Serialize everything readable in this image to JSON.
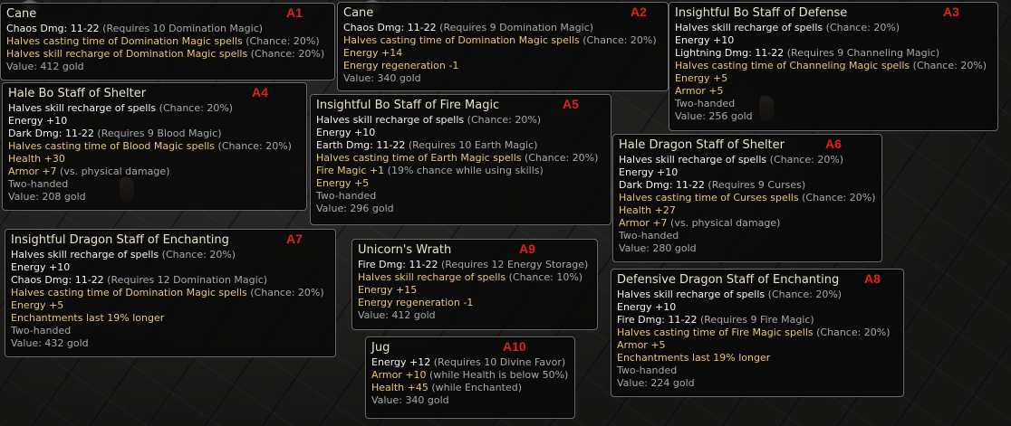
{
  "items": [
    {
      "id": "a1",
      "tag": "A1",
      "title": "Cane",
      "lines": [
        {
          "t": "Chaos Dmg: 11-22",
          "n": " (Requires 10 Domination Magic)",
          "c": "white"
        },
        {
          "t": "Halves casting time of Domination Magic spells",
          "n": " (Chance: 20%)",
          "c": "gold"
        },
        {
          "t": "Halves skill recharge of Domination Magic spells",
          "n": " (Chance: 20%)",
          "c": "gold"
        },
        {
          "t": "Value: 412 gold",
          "n": "",
          "c": "grey"
        }
      ]
    },
    {
      "id": "a2",
      "tag": "A2",
      "title": "Cane",
      "lines": [
        {
          "t": "Chaos Dmg: 11-22",
          "n": " (Requires 9 Domination Magic)",
          "c": "white"
        },
        {
          "t": "Halves casting time of Domination Magic spells",
          "n": " (Chance: 20%)",
          "c": "gold"
        },
        {
          "t": "Energy +14",
          "n": "",
          "c": "gold"
        },
        {
          "t": "Energy regeneration -1",
          "n": "",
          "c": "gold"
        },
        {
          "t": "Value: 340 gold",
          "n": "",
          "c": "grey"
        }
      ]
    },
    {
      "id": "a3",
      "tag": "A3",
      "title": "Insightful Bo Staff of Defense",
      "lines": [
        {
          "t": "Halves skill recharge of spells",
          "n": " (Chance: 20%)",
          "c": "white"
        },
        {
          "t": "Energy +10",
          "n": "",
          "c": "white"
        },
        {
          "t": "Lightning Dmg: 11-22",
          "n": " (Requires 9 Channeling Magic)",
          "c": "white"
        },
        {
          "t": "Halves casting time of Channeling Magic spells",
          "n": " (Chance: 20%)",
          "c": "gold"
        },
        {
          "t": "Energy +5",
          "n": "",
          "c": "gold"
        },
        {
          "t": "Armor +5",
          "n": "",
          "c": "gold"
        },
        {
          "t": "Two-handed",
          "n": "",
          "c": "grey"
        },
        {
          "t": "Value: 256 gold",
          "n": "",
          "c": "grey"
        }
      ]
    },
    {
      "id": "a4",
      "tag": "A4",
      "title": "Hale Bo Staff of Shelter",
      "lines": [
        {
          "t": "Halves skill recharge of spells",
          "n": " (Chance: 20%)",
          "c": "white"
        },
        {
          "t": "Energy +10",
          "n": "",
          "c": "white"
        },
        {
          "t": "Dark Dmg: 11-22",
          "n": " (Requires 9 Blood Magic)",
          "c": "white"
        },
        {
          "t": "Halves casting time of Blood Magic spells",
          "n": " (Chance: 20%)",
          "c": "gold"
        },
        {
          "t": "Health +30",
          "n": "",
          "c": "gold"
        },
        {
          "t": "Armor +7",
          "n": " (vs. physical damage)",
          "c": "gold"
        },
        {
          "t": "Two-handed",
          "n": "",
          "c": "grey"
        },
        {
          "t": "Value: 208 gold",
          "n": "",
          "c": "grey"
        }
      ]
    },
    {
      "id": "a5",
      "tag": "A5",
      "title": "Insightful Bo Staff of Fire Magic",
      "lines": [
        {
          "t": "Halves skill recharge of spells",
          "n": " (Chance: 20%)",
          "c": "white"
        },
        {
          "t": "Energy +10",
          "n": "",
          "c": "white"
        },
        {
          "t": "Earth Dmg: 11-22",
          "n": " (Requires 10 Earth Magic)",
          "c": "white"
        },
        {
          "t": "Halves casting time of Earth Magic spells",
          "n": " (Chance: 20%)",
          "c": "gold"
        },
        {
          "t": "Fire Magic +1",
          "n": " (19% chance while using skills)",
          "c": "gold"
        },
        {
          "t": "Energy +5",
          "n": "",
          "c": "gold"
        },
        {
          "t": "Two-handed",
          "n": "",
          "c": "grey"
        },
        {
          "t": "Value: 296 gold",
          "n": "",
          "c": "grey"
        }
      ]
    },
    {
      "id": "a6",
      "tag": "A6",
      "title": "Hale Dragon Staff of Shelter",
      "lines": [
        {
          "t": "Halves skill recharge of spells",
          "n": " (Chance: 20%)",
          "c": "white"
        },
        {
          "t": "Energy +10",
          "n": "",
          "c": "white"
        },
        {
          "t": "Dark Dmg: 11-22",
          "n": " (Requires 9 Curses)",
          "c": "white"
        },
        {
          "t": "Halves casting time of Curses spells",
          "n": " (Chance: 20%)",
          "c": "gold"
        },
        {
          "t": "Health +27",
          "n": "",
          "c": "gold"
        },
        {
          "t": "Armor +7",
          "n": " (vs. physical damage)",
          "c": "gold"
        },
        {
          "t": "Two-handed",
          "n": "",
          "c": "grey"
        },
        {
          "t": "Value: 280 gold",
          "n": "",
          "c": "grey"
        }
      ]
    },
    {
      "id": "a7",
      "tag": "A7",
      "title": "Insightful Dragon Staff of Enchanting",
      "lines": [
        {
          "t": "Halves skill recharge of spells",
          "n": " (Chance: 20%)",
          "c": "white"
        },
        {
          "t": "Energy +10",
          "n": "",
          "c": "white"
        },
        {
          "t": "Chaos Dmg: 11-22",
          "n": " (Requires 12 Domination Magic)",
          "c": "white"
        },
        {
          "t": "Halves casting time of Domination Magic spells",
          "n": " (Chance: 20%)",
          "c": "gold"
        },
        {
          "t": "Energy +5",
          "n": "",
          "c": "gold"
        },
        {
          "t": "Enchantments last 19% longer",
          "n": "",
          "c": "gold"
        },
        {
          "t": "Two-handed",
          "n": "",
          "c": "grey"
        },
        {
          "t": "Value: 432 gold",
          "n": "",
          "c": "grey"
        }
      ]
    },
    {
      "id": "a8",
      "tag": "A8",
      "title": "Defensive Dragon Staff of Enchanting",
      "lines": [
        {
          "t": "Halves skill recharge of spells",
          "n": " (Chance: 20%)",
          "c": "white"
        },
        {
          "t": "Energy +10",
          "n": "",
          "c": "white"
        },
        {
          "t": "Fire Dmg: 11-22",
          "n": " (Requires 9 Fire Magic)",
          "c": "white"
        },
        {
          "t": "Halves casting time of Fire Magic spells",
          "n": " (Chance: 20%)",
          "c": "gold"
        },
        {
          "t": "Armor +5",
          "n": "",
          "c": "gold"
        },
        {
          "t": "Enchantments last 19% longer",
          "n": "",
          "c": "gold"
        },
        {
          "t": "Two-handed",
          "n": "",
          "c": "grey"
        },
        {
          "t": "Value: 224 gold",
          "n": "",
          "c": "grey"
        }
      ]
    },
    {
      "id": "a9",
      "tag": "A9",
      "title": "Unicorn's Wrath",
      "lines": [
        {
          "t": "Fire Dmg: 11-22",
          "n": " (Requires 12 Energy Storage)",
          "c": "white"
        },
        {
          "t": "Halves skill recharge of spells",
          "n": " (Chance: 10%)",
          "c": "gold"
        },
        {
          "t": "Energy +15",
          "n": "",
          "c": "gold"
        },
        {
          "t": "Energy regeneration -1",
          "n": "",
          "c": "gold"
        },
        {
          "t": "Value: 412 gold",
          "n": "",
          "c": "grey"
        }
      ]
    },
    {
      "id": "a10",
      "tag": "A10",
      "title": "Jug",
      "lines": [
        {
          "t": "Energy +12",
          "n": " (Requires 10 Divine Favor)",
          "c": "white"
        },
        {
          "t": "Armor +10",
          "n": " (while Health is below 50%)",
          "c": "gold"
        },
        {
          "t": "Health +45",
          "n": " (while Enchanted)",
          "c": "gold"
        },
        {
          "t": "Value: 340 gold",
          "n": "",
          "c": "grey"
        }
      ]
    }
  ]
}
